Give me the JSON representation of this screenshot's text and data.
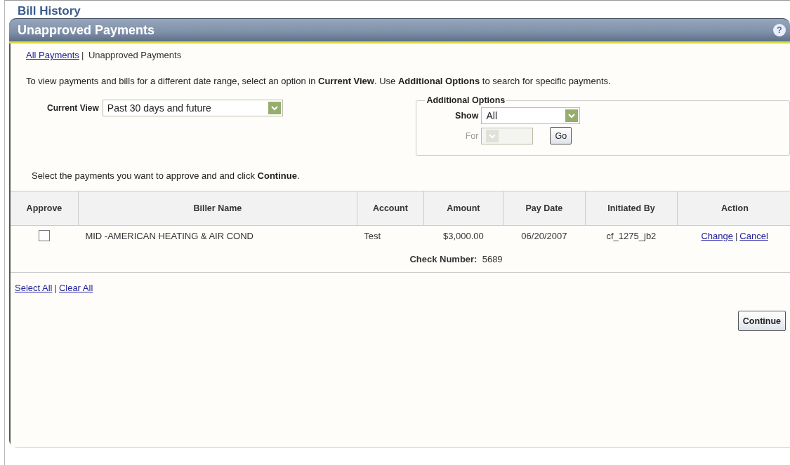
{
  "page_title": "Bill History",
  "panel": {
    "title": "Unapproved Payments",
    "help": "?"
  },
  "views": [
    {
      "label": "All Payments",
      "selected": false
    },
    {
      "label": "Unapproved Payments",
      "selected": true
    }
  ],
  "separator": "|",
  "intro": "To view payments and bills for a different date range, select an option in **Current View**. Use **Additional Options** to search for specific payments.",
  "current_view": {
    "label": "Current View",
    "value": "Past 30 days and future"
  },
  "additional_options": {
    "legend": "Additional Options",
    "show_label": "Show",
    "show_value": "All",
    "for_label": "For",
    "for_disabled": true,
    "go": "Go"
  },
  "instruction": "Select the payments you want to approve and and click **Continue**.",
  "table": {
    "columns": [
      "Approve",
      "Biller Name",
      "Account",
      "Amount",
      "Pay Date",
      "Initiated By",
      "Action"
    ],
    "rows": [
      {
        "checked": false,
        "biller": "MID -AMERICAN HEATING & AIR COND",
        "account": "Test",
        "amount": "$3,000.00",
        "pay_date": "06/20/2007",
        "initiated_by": "cf_1275_jb2",
        "actions": [
          "Change",
          "Cancel"
        ],
        "check_number_label": "Check Number:",
        "check_number": "5689"
      }
    ]
  },
  "bulk_links": [
    "Select All",
    "Clear All"
  ],
  "continue": "Continue"
}
